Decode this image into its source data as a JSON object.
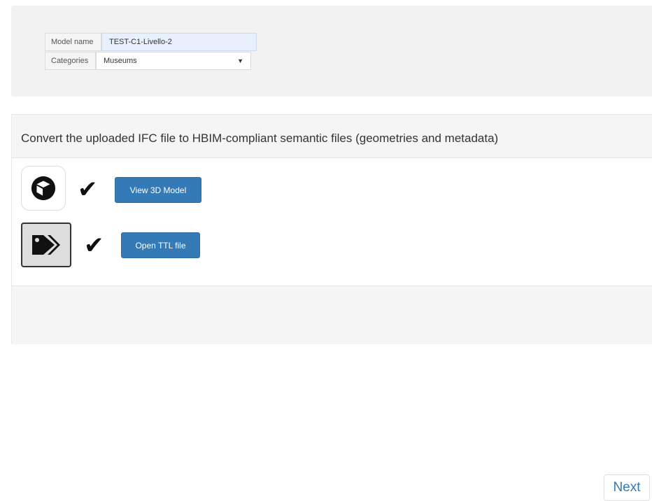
{
  "form": {
    "model_name_label": "Model name",
    "model_name_value": "TEST-C1-Livello-2",
    "categories_label": "Categories",
    "categories_value": "Museums"
  },
  "convert": {
    "heading": "Convert the uploaded IFC file to HBIM-compliant semantic files (geometries and metadata)",
    "items": [
      {
        "icon": "cube-icon",
        "status": "check",
        "button_label": "View 3D Model"
      },
      {
        "icon": "tags-icon",
        "status": "check",
        "button_label": "Open TTL file"
      }
    ]
  },
  "footer": {
    "next_label": "Next"
  },
  "colors": {
    "primary_button": "#337ab7",
    "panel_background": "#f2f2f2"
  }
}
